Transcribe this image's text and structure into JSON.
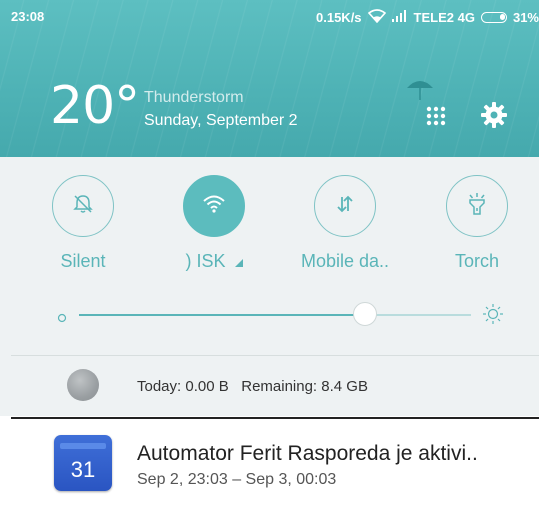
{
  "status_bar": {
    "time": "23:08",
    "speed": "0.15K/s",
    "carrier": "TELE2 4G",
    "battery": "31%",
    "icons": [
      "wifi-icon",
      "signal-icon",
      "battery-icon"
    ]
  },
  "weather": {
    "temperature": "20°",
    "condition": "Thunderstorm",
    "date": "Sunday, September 2",
    "icons": [
      "umbrella-icon",
      "app-grid-icon",
      "gear-icon"
    ]
  },
  "quick_tiles": [
    {
      "label": "Silent",
      "icon": "bell-off-icon",
      "active": false
    },
    {
      "label": ")   ISK",
      "icon": "wifi-icon",
      "active": true
    },
    {
      "label": "Mobile da..",
      "icon": "data-arrows-icon",
      "active": false
    },
    {
      "label": "Torch",
      "icon": "torch-icon",
      "active": false
    }
  ],
  "brightness": {
    "level": 0.73,
    "min_icon": "brightness-low-icon",
    "max_icon": "brightness-high-icon"
  },
  "data_usage": {
    "text": "Today: 0.00 B   Remaining: 8.4 GB"
  },
  "notification": {
    "app_icon": "calendar-icon",
    "icon_number": "31",
    "title": "Automator Ferit Rasporeda je aktivi..",
    "subtitle": "Sep 2, 23:03 – Sep 3, 00:03"
  },
  "colors": {
    "accent": "#5ab5b8",
    "header": "#4fb3b6",
    "panel_bg": "#eef2f3"
  }
}
